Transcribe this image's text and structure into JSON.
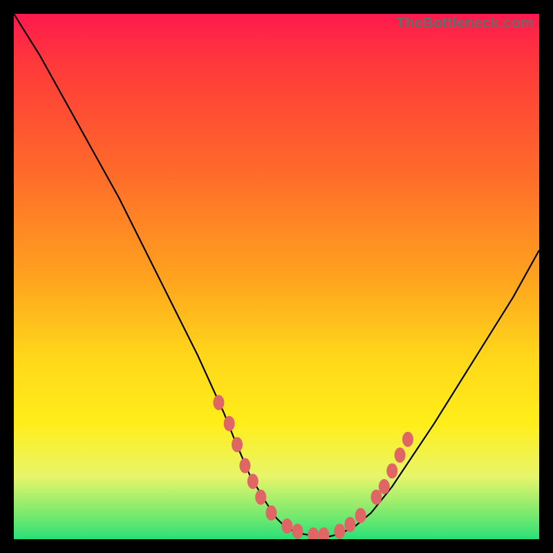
{
  "watermark": "TheBottleneck.com",
  "gradient_colors": {
    "top": "#ff1a4d",
    "upper_mid": "#ff6a2a",
    "mid": "#ffd61a",
    "lower_mid": "#ffee1a",
    "bottom": "#28e07a"
  },
  "chart_data": {
    "type": "line",
    "title": "",
    "xlabel": "",
    "ylabel": "",
    "xlim": [
      0,
      100
    ],
    "ylim": [
      0,
      100
    ],
    "series": [
      {
        "name": "bottleneck-curve",
        "x": [
          0,
          5,
          10,
          15,
          20,
          25,
          30,
          35,
          40,
          42,
          45,
          48,
          50,
          52,
          55,
          58,
          60,
          62,
          65,
          68,
          72,
          76,
          80,
          85,
          90,
          95,
          100
        ],
        "y": [
          100,
          92,
          83,
          74,
          65,
          55,
          45,
          35,
          24,
          19,
          12,
          7,
          4,
          2,
          1,
          0.5,
          0.5,
          1,
          2.5,
          5,
          10,
          16,
          22,
          30,
          38,
          46,
          55
        ]
      }
    ],
    "markers": {
      "name": "highlighted-points",
      "color": "#e06666",
      "points": [
        {
          "x": 39,
          "y": 26
        },
        {
          "x": 41,
          "y": 22
        },
        {
          "x": 42.5,
          "y": 18
        },
        {
          "x": 44,
          "y": 14
        },
        {
          "x": 45.5,
          "y": 11
        },
        {
          "x": 47,
          "y": 8
        },
        {
          "x": 49,
          "y": 5
        },
        {
          "x": 52,
          "y": 2.5
        },
        {
          "x": 54,
          "y": 1.5
        },
        {
          "x": 57,
          "y": 0.8
        },
        {
          "x": 59,
          "y": 0.8
        },
        {
          "x": 62,
          "y": 1.5
        },
        {
          "x": 64,
          "y": 2.8
        },
        {
          "x": 66,
          "y": 4.5
        },
        {
          "x": 69,
          "y": 8
        },
        {
          "x": 70.5,
          "y": 10
        },
        {
          "x": 72,
          "y": 13
        },
        {
          "x": 73.5,
          "y": 16
        },
        {
          "x": 75,
          "y": 19
        }
      ]
    }
  }
}
